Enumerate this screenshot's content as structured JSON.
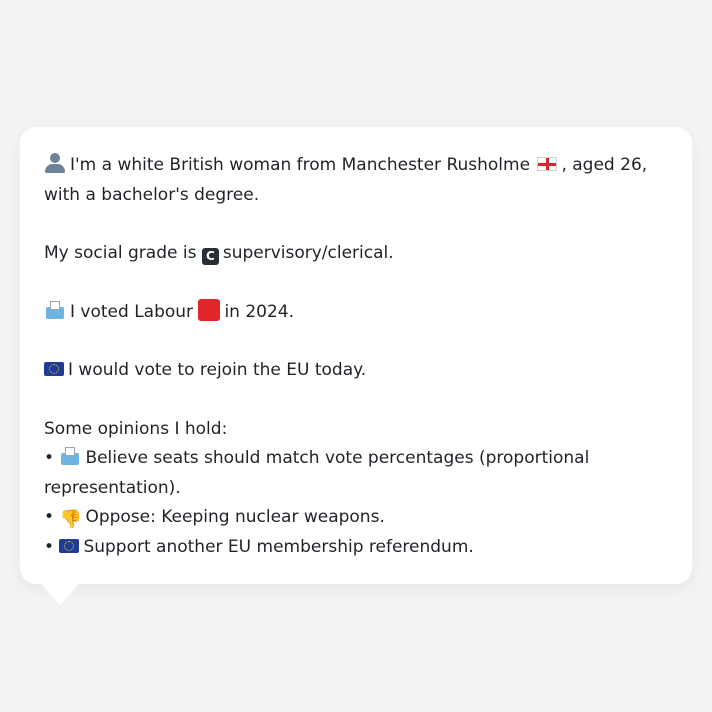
{
  "profile": {
    "line1_pre": "I'm a white British woman from Manchester Rusholme",
    "line1_post": ", aged 26, with a bachelor's degree.",
    "social_pre": "My social grade is",
    "social_badge": "C",
    "social_post": "supervisory/clerical.",
    "vote_pre": "I voted Labour",
    "vote_post": "in 2024.",
    "eu_text": "I would vote to rejoin the EU today.",
    "opinions_heading": "Some opinions I hold:",
    "opinions": [
      {
        "bullet": "•",
        "icon": "ballot-box-icon",
        "text": "Believe seats should match vote percentages (proportional representation)."
      },
      {
        "bullet": "•",
        "icon": "thumbs-down-icon",
        "text": "Oppose: Keeping nuclear weapons."
      },
      {
        "bullet": "•",
        "icon": "eu-flag-icon",
        "text": "Support another EU membership referendum."
      }
    ]
  },
  "colors": {
    "labour_red": "#e0262b",
    "eu_blue": "#1e3c96",
    "england_red": "#d6262b"
  }
}
